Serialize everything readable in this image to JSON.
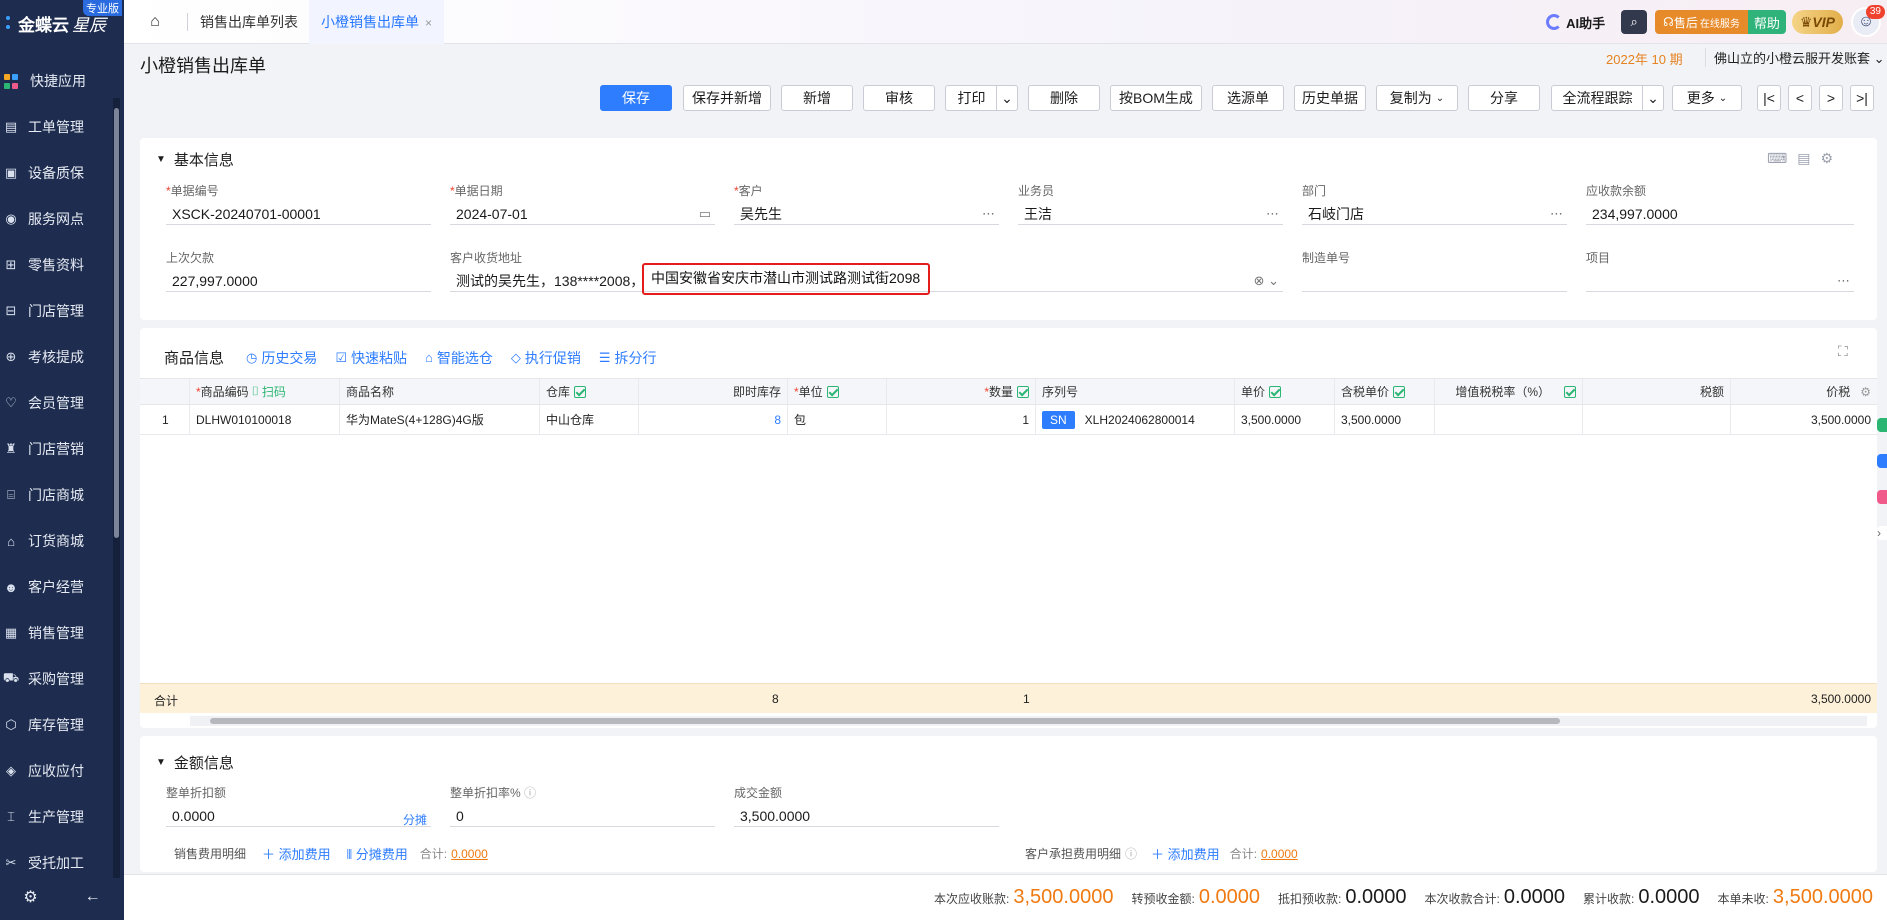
{
  "brand": {
    "name": "金蝶云",
    "sub": "星辰",
    "edition": "专业版"
  },
  "nav": [
    {
      "label": "快捷应用",
      "icon": "apps-icon"
    },
    {
      "label": "工单管理",
      "icon": "ticket-icon"
    },
    {
      "label": "设备质保",
      "icon": "device-icon"
    },
    {
      "label": "服务网点",
      "icon": "service-point-icon"
    },
    {
      "label": "零售资料",
      "icon": "basket-icon"
    },
    {
      "label": "门店管理",
      "icon": "store-icon"
    },
    {
      "label": "考核提成",
      "icon": "commission-icon"
    },
    {
      "label": "会员管理",
      "icon": "member-icon"
    },
    {
      "label": "门店营销",
      "icon": "marketing-icon"
    },
    {
      "label": "门店商城",
      "icon": "mall-icon"
    },
    {
      "label": "订货商城",
      "icon": "order-mall-icon"
    },
    {
      "label": "客户经营",
      "icon": "customer-icon"
    },
    {
      "label": "销售管理",
      "icon": "sales-icon"
    },
    {
      "label": "采购管理",
      "icon": "cart-icon"
    },
    {
      "label": "库存管理",
      "icon": "inventory-icon"
    },
    {
      "label": "应收应付",
      "icon": "finance-icon"
    },
    {
      "label": "生产管理",
      "icon": "factory-icon"
    },
    {
      "label": "受托加工",
      "icon": "tools-icon"
    }
  ],
  "tabs": {
    "list": "销售出库单列表",
    "active": "小橙销售出库单"
  },
  "topright": {
    "ai": "AI助手",
    "service": "售后",
    "service_small": "在线服务",
    "help": "帮助",
    "vip": "VIP",
    "badge": "39"
  },
  "page": {
    "title": "小橙销售出库单",
    "period": "2022年 10 期",
    "org": "佛山立的小橙云服开发账套"
  },
  "toolbar": {
    "save": "保存",
    "save_new": "保存并新增",
    "new": "新增",
    "audit": "审核",
    "print": "打印",
    "delete": "删除",
    "bom": "按BOM生成",
    "select_src": "选源单",
    "history": "历史单据",
    "copy_as": "复制为",
    "share": "分享",
    "trace": "全流程跟踪",
    "more": "更多"
  },
  "basic": {
    "title": "基本信息",
    "bill_no": {
      "label": "单据编号",
      "value": "XSCK-20240701-00001"
    },
    "bill_date": {
      "label": "单据日期",
      "value": "2024-07-01"
    },
    "customer": {
      "label": "客户",
      "value": "吴先生"
    },
    "salesman": {
      "label": "业务员",
      "value": "王洁"
    },
    "dept": {
      "label": "部门",
      "value": "石岐门店"
    },
    "receivable": {
      "label": "应收款余额",
      "value": "234,997.0000"
    },
    "last_debt": {
      "label": "上次欠款",
      "value": "227,997.0000"
    },
    "address": {
      "label": "客户收货地址",
      "prefix": "测试的吴先生，138****2008，",
      "highlight": "中国安徽省安庆市潜山市测试路测试街2098"
    },
    "mfg_no": {
      "label": "制造单号",
      "value": ""
    },
    "project": {
      "label": "项目",
      "value": ""
    }
  },
  "items": {
    "title": "商品信息",
    "tools": [
      "历史交易",
      "快速粘贴",
      "智能选仓",
      "执行促销",
      "拆分行"
    ],
    "scan": "扫码",
    "headers": {
      "code": "商品编码",
      "name": "商品名称",
      "wh": "仓库",
      "stock": "即时库存",
      "unit": "单位",
      "qty": "数量",
      "serial": "序列号",
      "price": "单价",
      "tax_price": "含税单价",
      "vat_rate": "增值税税率（%）",
      "tax": "税额",
      "amount": "价税"
    },
    "rows": [
      {
        "no": "1",
        "code": "DLHW010100018",
        "name": "华为MateS(4+128G)4G版",
        "wh": "中山仓库",
        "stock": "8",
        "unit": "包",
        "qty": "1",
        "sn": "SN",
        "serial": "XLH2024062800014",
        "price": "3,500.0000",
        "tax_price": "3,500.0000",
        "vat_rate": "",
        "tax": "",
        "amount": "3,500.0000"
      }
    ],
    "total": {
      "label": "合计",
      "stock": "8",
      "qty": "1",
      "amount": "3,500.0000"
    }
  },
  "amount_sec": {
    "title": "金额信息",
    "discount": {
      "label": "整单折扣额",
      "value": "0.0000",
      "link": "分摊"
    },
    "discount_rate": {
      "label": "整单折扣率%",
      "value": "0"
    },
    "deal": {
      "label": "成交金额",
      "value": "3,500.0000"
    },
    "sales_fee": {
      "label": "销售费用明细",
      "add": "添加费用",
      "share": "分摊费用",
      "sum_label": "合计:",
      "sum": "0.0000"
    },
    "cust_fee": {
      "label": "客户承担费用明细",
      "add": "添加费用",
      "sum_label": "合计:",
      "sum": "0.0000"
    }
  },
  "footer": [
    {
      "label": "本次应收账款:",
      "value": "3,500.0000",
      "orange": true
    },
    {
      "label": "转预收金额:",
      "value": "0.0000",
      "orange": true
    },
    {
      "label": "抵扣预收款:",
      "value": "0.0000",
      "orange": false
    },
    {
      "label": "本次收款合计:",
      "value": "0.0000",
      "orange": false
    },
    {
      "label": "累计收款:",
      "value": "0.0000",
      "orange": false
    },
    {
      "label": "本单未收:",
      "value": "3,500.0000",
      "orange": true
    }
  ],
  "colors": {
    "primary": "#2e7dff",
    "sidebar": "#1e2d4f",
    "highlight_border": "#e41c1c",
    "orange": "#f07a12"
  }
}
